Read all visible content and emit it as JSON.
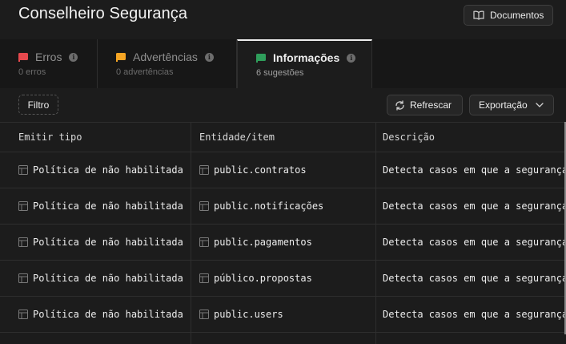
{
  "header": {
    "title": "Conselheiro Segurança",
    "docs_label": "Documentos"
  },
  "tabs": [
    {
      "label": "Erros",
      "sub": "0 erros",
      "flag_color": "#e5484d"
    },
    {
      "label": "Advertências",
      "sub": "0 advertências",
      "flag_color": "#f5a524"
    },
    {
      "label": "Informações",
      "sub": "6 sugestões",
      "flag_color": "#2f9e5b"
    }
  ],
  "toolbar": {
    "filter_label": "Filtro",
    "refresh_label": "Refrescar",
    "export_label": "Exportação"
  },
  "table": {
    "columns": [
      "Emitir tipo",
      "Entidade/item",
      "Descrição"
    ],
    "rows": [
      {
        "type": "Política de não habilitada",
        "entity": "public.contratos",
        "desc": "Detecta casos em que a segurança"
      },
      {
        "type": "Política de não habilitada",
        "entity": "public.notificações",
        "desc": "Detecta casos em que a segurança"
      },
      {
        "type": "Política de não habilitada",
        "entity": "public.pagamentos",
        "desc": "Detecta casos em que a segurança"
      },
      {
        "type": "Política de não habilitada",
        "entity": "público.propostas",
        "desc": "Detecta casos em que a segurança"
      },
      {
        "type": "Política de não habilitada",
        "entity": "public.users",
        "desc": "Detecta casos em que a segurança"
      }
    ]
  }
}
